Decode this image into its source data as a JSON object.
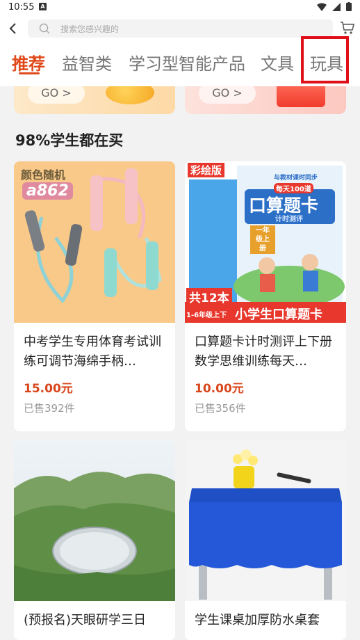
{
  "status": {
    "time": "10:55",
    "notif": "A"
  },
  "search": {
    "placeholder": "搜索您感兴趣的"
  },
  "tabs": [
    {
      "label": "推荐"
    },
    {
      "label": "益智类"
    },
    {
      "label": "学习型智能产品"
    },
    {
      "label": "文具"
    },
    {
      "label": "玩具"
    }
  ],
  "promos": [
    {
      "go": "GO >"
    },
    {
      "go": "GO >"
    }
  ],
  "section": {
    "title": "98%学生都在买"
  },
  "products": [
    {
      "name": "中考学生专用体育考试训练可调节海绵手柄…",
      "price": "15.00元",
      "sold": "已售392件",
      "image_text": [
        "颜色随机",
        "a862"
      ]
    },
    {
      "name": "口算题卡计时测评上下册数学思维训练每天…",
      "price": "10.00元",
      "sold": "已售356件",
      "image_text": [
        "彩绘版",
        "口算题卡",
        "共12本",
        "小学生口算题卡",
        "一年级上册",
        "1-6年级上下",
        "每天100道",
        "计时测评",
        "与教材课时同步"
      ]
    },
    {
      "name": "(预报名)天眼研学三日"
    },
    {
      "name": "学生课桌加厚防水桌套"
    }
  ],
  "colors": {
    "accent": "#e0491a",
    "highlight": "#e0101a",
    "price": "#d9461c"
  }
}
